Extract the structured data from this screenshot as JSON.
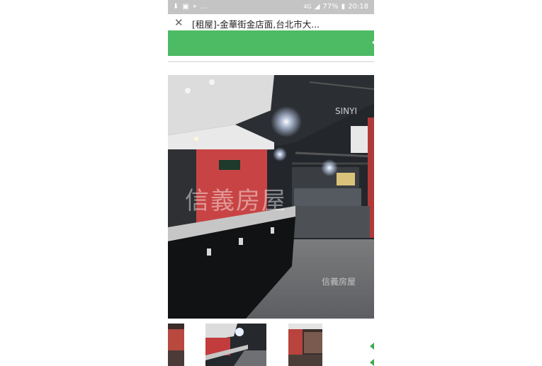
{
  "status_bar": {
    "left_icons": [
      "download-icon",
      "image-icon",
      "location-icon"
    ],
    "more": "...",
    "network": "4G",
    "battery": "77%",
    "time": "20:18"
  },
  "header": {
    "title": "[租屋]-金華街金店面,台北市大...",
    "close_symbol": "✕"
  },
  "colors": {
    "green_bar": "#4dba64",
    "status_bar": "#c4c4c4"
  },
  "photo": {
    "watermark_main": "信義房屋",
    "watermark_brand": "SINYI",
    "watermark_small": "信義房屋"
  },
  "thumbnails": {
    "count_visible": 3
  }
}
